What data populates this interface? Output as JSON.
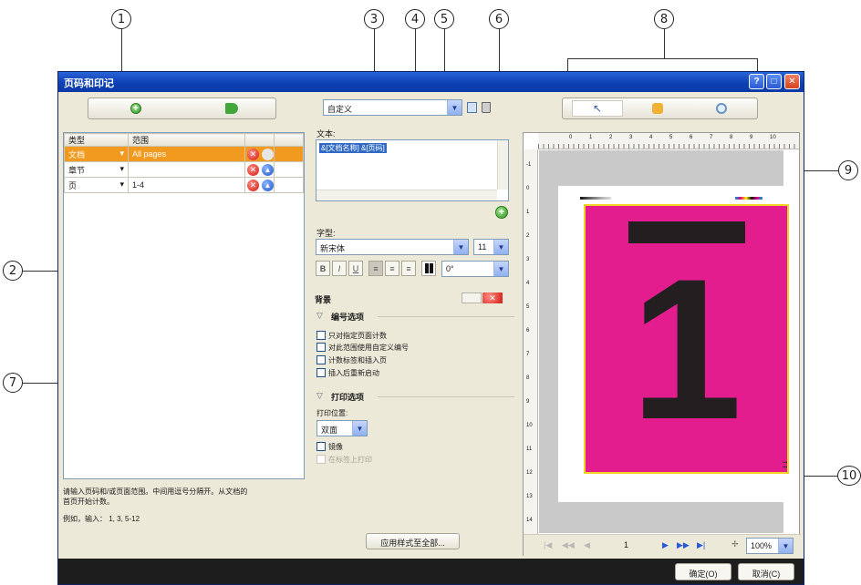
{
  "callouts": [
    "1",
    "2",
    "3",
    "4",
    "5",
    "6",
    "7",
    "8",
    "9",
    "10"
  ],
  "window": {
    "title": "页码和印记",
    "title_buttons": [
      "?",
      "□",
      "✕"
    ]
  },
  "left_toolbar": {
    "add_icon": "add-icon",
    "tag_icon": "tag-icon"
  },
  "rules_table": {
    "headers": [
      "类型",
      "范围"
    ],
    "rows": [
      {
        "type": "文档",
        "range": "All pages",
        "selected": true
      },
      {
        "type": "章节",
        "range": "",
        "selected": false
      },
      {
        "type": "页",
        "range": "1-4",
        "selected": false
      }
    ]
  },
  "help": {
    "text_line1": "请输入页码和/或页面范围。中间用逗号分隔开。从文档的",
    "text_line2": "首页开始计数。",
    "example": "例如，输入： 1, 3, 5-12"
  },
  "style_preset": {
    "value": "自定义"
  },
  "text_section": {
    "label": "文本:",
    "value": "&[文档名称] &[页码]"
  },
  "font_section": {
    "label": "字型:",
    "font": "新宋体",
    "size": "11",
    "rotation": "0°",
    "format_buttons": [
      "B",
      "I",
      "U"
    ]
  },
  "background": {
    "label": "背景"
  },
  "numbering": {
    "label": "编号选项",
    "options": [
      "只对指定页面计数",
      "对此范围使用自定义编号",
      "计数标签和插入页",
      "插入后重新启动"
    ]
  },
  "print": {
    "label": "打印选项",
    "position_label": "打印位置:",
    "position_value": "双面",
    "mirror": "镜像",
    "on_tabs": "在标签上打印"
  },
  "apply_button": "应用样式至全部...",
  "preview": {
    "tools": [
      "pointer-tool",
      "hand-tool",
      "zoom-tool"
    ],
    "ruler_top": [
      "0",
      "1",
      "2",
      "3",
      "4",
      "5",
      "6",
      "7",
      "8",
      "9",
      "10"
    ],
    "ruler_left": [
      "-1",
      "0",
      "1",
      "2",
      "3",
      "4",
      "5",
      "6",
      "7",
      "8",
      "9",
      "10",
      "11",
      "12",
      "13",
      "14"
    ],
    "big_digit": "1",
    "colors": {
      "page_fill": "#e41d8f",
      "bleed_border": "#f3d323",
      "slug": "#d0d0d0"
    }
  },
  "nav": {
    "page": "1",
    "zoom": "100%"
  },
  "dialog_buttons": {
    "ok": "确定(O)",
    "cancel": "取消(C)"
  }
}
